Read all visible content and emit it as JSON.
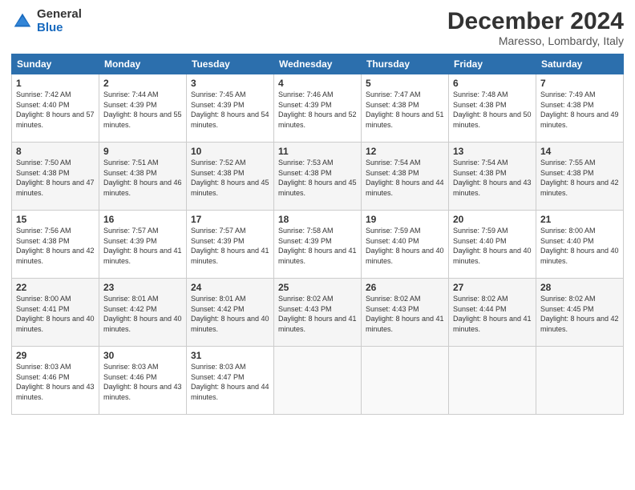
{
  "logo": {
    "general": "General",
    "blue": "Blue"
  },
  "title": "December 2024",
  "location": "Maresso, Lombardy, Italy",
  "days_of_week": [
    "Sunday",
    "Monday",
    "Tuesday",
    "Wednesday",
    "Thursday",
    "Friday",
    "Saturday"
  ],
  "weeks": [
    [
      {
        "day": "1",
        "sunrise": "7:42 AM",
        "sunset": "4:40 PM",
        "daylight": "8 hours and 57 minutes."
      },
      {
        "day": "2",
        "sunrise": "7:44 AM",
        "sunset": "4:39 PM",
        "daylight": "8 hours and 55 minutes."
      },
      {
        "day": "3",
        "sunrise": "7:45 AM",
        "sunset": "4:39 PM",
        "daylight": "8 hours and 54 minutes."
      },
      {
        "day": "4",
        "sunrise": "7:46 AM",
        "sunset": "4:39 PM",
        "daylight": "8 hours and 52 minutes."
      },
      {
        "day": "5",
        "sunrise": "7:47 AM",
        "sunset": "4:38 PM",
        "daylight": "8 hours and 51 minutes."
      },
      {
        "day": "6",
        "sunrise": "7:48 AM",
        "sunset": "4:38 PM",
        "daylight": "8 hours and 50 minutes."
      },
      {
        "day": "7",
        "sunrise": "7:49 AM",
        "sunset": "4:38 PM",
        "daylight": "8 hours and 49 minutes."
      }
    ],
    [
      {
        "day": "8",
        "sunrise": "7:50 AM",
        "sunset": "4:38 PM",
        "daylight": "8 hours and 47 minutes."
      },
      {
        "day": "9",
        "sunrise": "7:51 AM",
        "sunset": "4:38 PM",
        "daylight": "8 hours and 46 minutes."
      },
      {
        "day": "10",
        "sunrise": "7:52 AM",
        "sunset": "4:38 PM",
        "daylight": "8 hours and 45 minutes."
      },
      {
        "day": "11",
        "sunrise": "7:53 AM",
        "sunset": "4:38 PM",
        "daylight": "8 hours and 45 minutes."
      },
      {
        "day": "12",
        "sunrise": "7:54 AM",
        "sunset": "4:38 PM",
        "daylight": "8 hours and 44 minutes."
      },
      {
        "day": "13",
        "sunrise": "7:54 AM",
        "sunset": "4:38 PM",
        "daylight": "8 hours and 43 minutes."
      },
      {
        "day": "14",
        "sunrise": "7:55 AM",
        "sunset": "4:38 PM",
        "daylight": "8 hours and 42 minutes."
      }
    ],
    [
      {
        "day": "15",
        "sunrise": "7:56 AM",
        "sunset": "4:38 PM",
        "daylight": "8 hours and 42 minutes."
      },
      {
        "day": "16",
        "sunrise": "7:57 AM",
        "sunset": "4:39 PM",
        "daylight": "8 hours and 41 minutes."
      },
      {
        "day": "17",
        "sunrise": "7:57 AM",
        "sunset": "4:39 PM",
        "daylight": "8 hours and 41 minutes."
      },
      {
        "day": "18",
        "sunrise": "7:58 AM",
        "sunset": "4:39 PM",
        "daylight": "8 hours and 41 minutes."
      },
      {
        "day": "19",
        "sunrise": "7:59 AM",
        "sunset": "4:40 PM",
        "daylight": "8 hours and 40 minutes."
      },
      {
        "day": "20",
        "sunrise": "7:59 AM",
        "sunset": "4:40 PM",
        "daylight": "8 hours and 40 minutes."
      },
      {
        "day": "21",
        "sunrise": "8:00 AM",
        "sunset": "4:40 PM",
        "daylight": "8 hours and 40 minutes."
      }
    ],
    [
      {
        "day": "22",
        "sunrise": "8:00 AM",
        "sunset": "4:41 PM",
        "daylight": "8 hours and 40 minutes."
      },
      {
        "day": "23",
        "sunrise": "8:01 AM",
        "sunset": "4:42 PM",
        "daylight": "8 hours and 40 minutes."
      },
      {
        "day": "24",
        "sunrise": "8:01 AM",
        "sunset": "4:42 PM",
        "daylight": "8 hours and 40 minutes."
      },
      {
        "day": "25",
        "sunrise": "8:02 AM",
        "sunset": "4:43 PM",
        "daylight": "8 hours and 41 minutes."
      },
      {
        "day": "26",
        "sunrise": "8:02 AM",
        "sunset": "4:43 PM",
        "daylight": "8 hours and 41 minutes."
      },
      {
        "day": "27",
        "sunrise": "8:02 AM",
        "sunset": "4:44 PM",
        "daylight": "8 hours and 41 minutes."
      },
      {
        "day": "28",
        "sunrise": "8:02 AM",
        "sunset": "4:45 PM",
        "daylight": "8 hours and 42 minutes."
      }
    ],
    [
      {
        "day": "29",
        "sunrise": "8:03 AM",
        "sunset": "4:46 PM",
        "daylight": "8 hours and 43 minutes."
      },
      {
        "day": "30",
        "sunrise": "8:03 AM",
        "sunset": "4:46 PM",
        "daylight": "8 hours and 43 minutes."
      },
      {
        "day": "31",
        "sunrise": "8:03 AM",
        "sunset": "4:47 PM",
        "daylight": "8 hours and 44 minutes."
      },
      null,
      null,
      null,
      null
    ]
  ]
}
